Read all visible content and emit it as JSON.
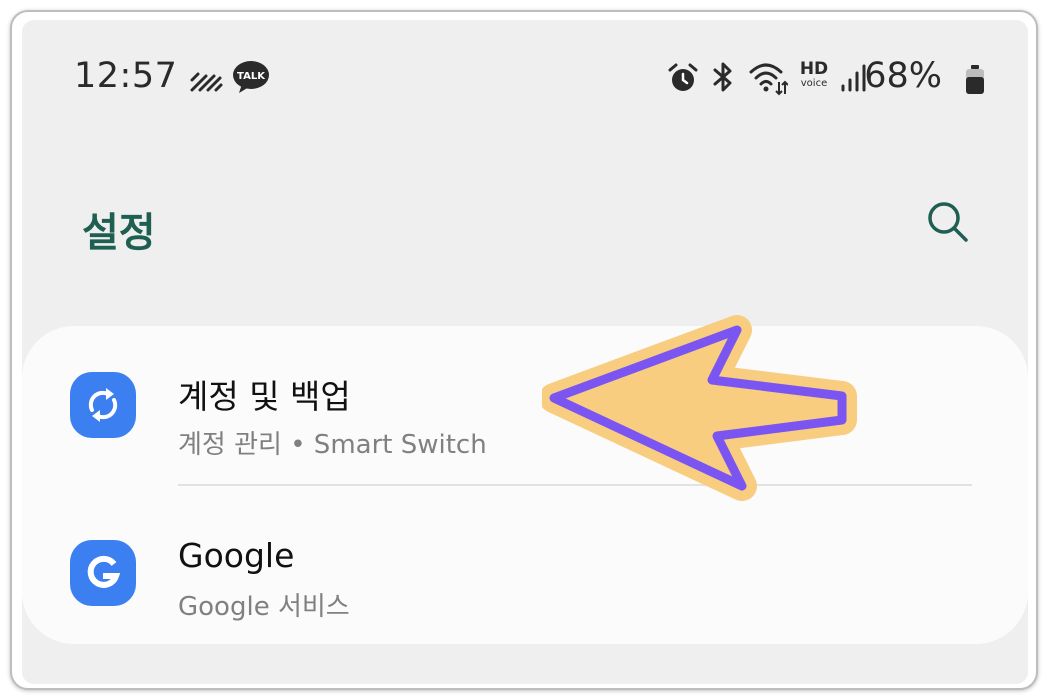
{
  "status_bar": {
    "time": "12:57",
    "notification_icons": [
      "signal-noise-icon",
      "kakaotalk-icon"
    ],
    "kakaotalk_badge": "TALK",
    "system_icons": [
      "alarm-icon",
      "bluetooth-icon",
      "wifi-icon",
      "hd-voice-icon",
      "cell-signal-icon"
    ],
    "hd_label": "HD",
    "voice_label": "voice",
    "battery": "68%"
  },
  "header": {
    "title": "설정",
    "search_icon": "search-icon"
  },
  "settings": [
    {
      "title": "계정 및 백업",
      "subtitle": "계정 관리 • Smart Switch",
      "icon": "sync-icon",
      "icon_color": "#3b7ff0"
    },
    {
      "title": "Google",
      "subtitle": "Google 서비스",
      "icon": "google-icon",
      "icon_color": "#3b7ff0"
    }
  ],
  "annotation": {
    "icon": "pointer-arrow-icon",
    "fill_color": "#f8cd80",
    "stroke_color": "#7b55f2"
  },
  "colors": {
    "title": "#1f5f52",
    "background": "#efefef",
    "card": "#fbfbfb"
  }
}
